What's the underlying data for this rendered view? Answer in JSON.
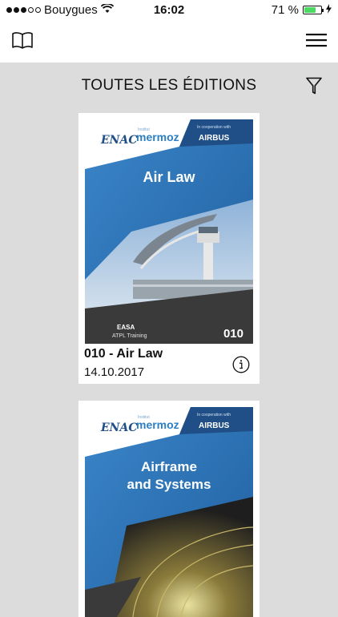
{
  "status": {
    "carrier": "Bouygues",
    "time": "16:02",
    "battery_percent_label": "71 %",
    "battery_level": 0.71
  },
  "nav": {
    "left_icon": "book-icon",
    "right_icon": "hamburger-menu-icon"
  },
  "header": {
    "title": "TOUTES LES ÉDITIONS",
    "filter_icon": "filter-icon"
  },
  "colors": {
    "accent_blue": "#2e74b8",
    "cover_dark": "#3a3a3a",
    "background": "#dcdcdc"
  },
  "editions": [
    {
      "title": "010 - Air Law",
      "date": "14.10.2017",
      "cover": {
        "logo_left": "ENAC",
        "logo_mid_top": "Institut",
        "logo_mid": "mermoz",
        "cooperation": "In cooperation with",
        "partner": "AIRBUS",
        "subject": "Air Law",
        "badge_line1": "EASA",
        "badge_line2": "ATPL Training",
        "code": "010"
      }
    },
    {
      "title": "",
      "date": "",
      "cover": {
        "logo_left": "ENAC",
        "logo_mid_top": "Institut",
        "logo_mid": "mermoz",
        "cooperation": "In cooperation with",
        "partner": "AIRBUS",
        "subject_line1": "Airframe",
        "subject_line2": "and Systems"
      }
    }
  ]
}
